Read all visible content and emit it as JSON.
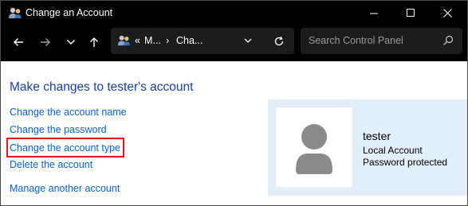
{
  "window": {
    "title": "Change an Account"
  },
  "address": {
    "prefix": "«",
    "crumb1": "M...",
    "separator": "›",
    "crumb2": "Cha..."
  },
  "search": {
    "placeholder": "Search Control Panel"
  },
  "main": {
    "heading": "Make changes to tester's account",
    "links": [
      "Change the account name",
      "Change the password",
      "Change the account type",
      "Delete the account"
    ],
    "manage_link": "Manage another account",
    "highlighted_link_index": 2
  },
  "user": {
    "name": "tester",
    "account_kind": "Local Account",
    "password_status": "Password protected"
  },
  "icons": {
    "app": "users-icon",
    "back": "arrow-left-icon",
    "forward": "arrow-right-icon",
    "recent": "chevron-down-icon",
    "up": "arrow-up-icon",
    "refresh": "refresh-icon",
    "search": "search-icon",
    "avatar": "user-avatar-icon"
  },
  "colors": {
    "titlebar_bg": "#000000",
    "link": "#0b62c4",
    "heading": "#1c3f94",
    "user_panel_bg": "#e3eefb",
    "highlight_border": "#e0141e"
  }
}
